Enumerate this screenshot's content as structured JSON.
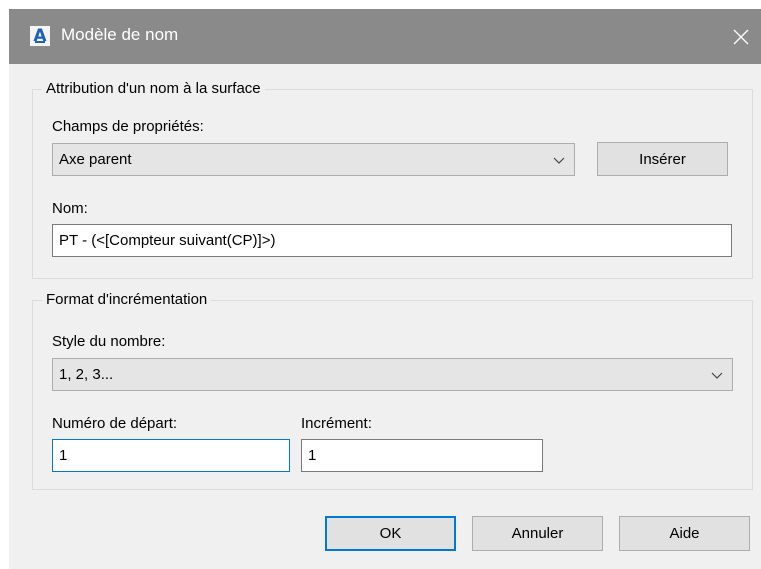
{
  "window": {
    "title": "Modèle de nom",
    "app_icon_glyph": "A",
    "close_glyph": "✕"
  },
  "naming_group": {
    "legend": "Attribution d'un nom à la surface",
    "property_fields_label": "Champs de propriétés:",
    "property_fields_value": "Axe parent",
    "insert_button": "Insérer",
    "name_label": "Nom:",
    "name_value": "PT - (<[Compteur suivant(CP)]>)"
  },
  "increment_group": {
    "legend": "Format d'incrémentation",
    "number_style_label": "Style du nombre:",
    "number_style_value": "1, 2, 3...",
    "start_number_label": "Numéro de départ:",
    "start_number_value": "1",
    "increment_label": "Incrément:",
    "increment_value": "1"
  },
  "buttons": {
    "ok": "OK",
    "cancel": "Annuler",
    "help": "Aide"
  },
  "colors": {
    "titlebar": "#8a8a8a",
    "dialog_bg": "#f0f0f0",
    "accent": "#0078d7",
    "app_icon_blue": "#1c63b7"
  },
  "icons": {
    "app": "autocad-a-icon",
    "close": "close-icon",
    "dropdown": "chevron-down-icon"
  }
}
